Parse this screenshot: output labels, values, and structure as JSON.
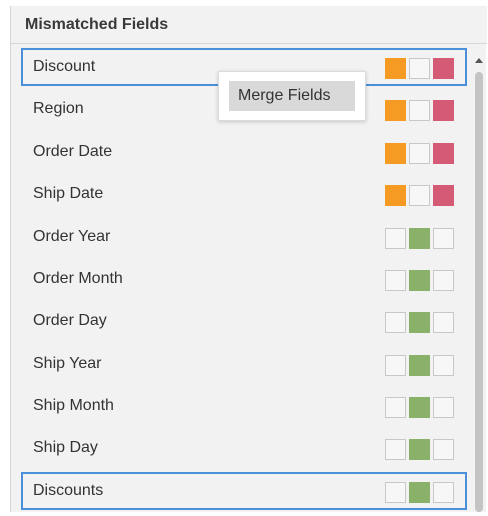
{
  "header": {
    "title": "Mismatched Fields"
  },
  "context_menu": {
    "merge_label": "Merge Fields"
  },
  "colors": {
    "selection_border": "#4a90d9",
    "orange": "#f59a23",
    "red": "#d45a76",
    "green": "#8ab16a",
    "empty": "#f7f7f7"
  },
  "fields": [
    {
      "label": "Discount",
      "selected": true,
      "swatches": [
        "orange",
        "empty",
        "red"
      ]
    },
    {
      "label": "Region",
      "selected": false,
      "swatches": [
        "orange",
        "empty",
        "red"
      ]
    },
    {
      "label": "Order Date",
      "selected": false,
      "swatches": [
        "orange",
        "empty",
        "red"
      ]
    },
    {
      "label": "Ship Date",
      "selected": false,
      "swatches": [
        "orange",
        "empty",
        "red"
      ]
    },
    {
      "label": "Order Year",
      "selected": false,
      "swatches": [
        "empty",
        "green",
        "empty"
      ]
    },
    {
      "label": "Order Month",
      "selected": false,
      "swatches": [
        "empty",
        "green",
        "empty"
      ]
    },
    {
      "label": "Order Day",
      "selected": false,
      "swatches": [
        "empty",
        "green",
        "empty"
      ]
    },
    {
      "label": "Ship Year",
      "selected": false,
      "swatches": [
        "empty",
        "green",
        "empty"
      ]
    },
    {
      "label": "Ship Month",
      "selected": false,
      "swatches": [
        "empty",
        "green",
        "empty"
      ]
    },
    {
      "label": "Ship Day",
      "selected": false,
      "swatches": [
        "empty",
        "green",
        "empty"
      ]
    },
    {
      "label": "Discounts",
      "selected": true,
      "swatches": [
        "empty",
        "green",
        "empty"
      ]
    }
  ]
}
